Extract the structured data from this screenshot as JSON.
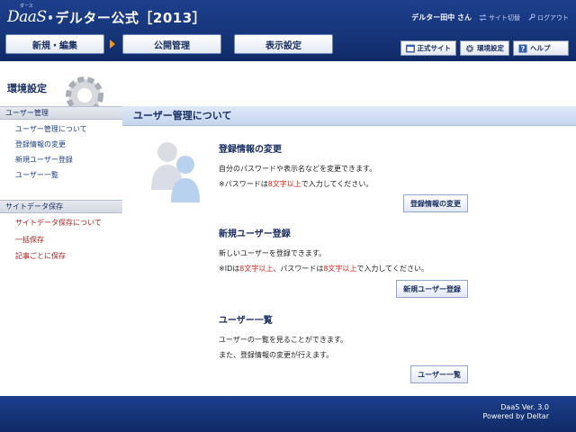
{
  "header": {
    "logo_daas": "DaaS",
    "logo_ruby": "ダース",
    "logo_title": "デルター公式［2013］",
    "user_name": "デルター田中 さん",
    "site_switch": "サイト切替",
    "logout": "ログアウト",
    "nav": [
      "新規・編集",
      "公開管理",
      "表示設定"
    ],
    "tools": {
      "official_site": "正式サイト",
      "env_settings": "環境設定",
      "help": "ヘルプ"
    }
  },
  "sidebar": {
    "title": "環境設定",
    "sections": [
      {
        "heading": "ユーザー管理",
        "items": [
          "ユーザー管理について",
          "登録情報の変更",
          "新規ユーザー登録",
          "ユーザー一覧"
        ]
      },
      {
        "heading": "サイトデータ保存",
        "items": [
          "サイトデータ保存について",
          "一括保存",
          "記事ごとに保存"
        ]
      }
    ]
  },
  "main": {
    "heading": "ユーザー管理について",
    "blocks": [
      {
        "title": "登録情報の変更",
        "line1": "自分のパスワードや表示名などを変更できます。",
        "line2_pre": "※パスワードは",
        "line2_red1": "8文字以上",
        "line2_post": "で入力してください。",
        "button": "登録情報の変更"
      },
      {
        "title": "新規ユーザー登録",
        "line1": "新しいユーザーを登録できます。",
        "line2_pre": "※IDは",
        "line2_red1": "8文字以上",
        "line2_mid": "、パスワードは",
        "line2_red2": "8文字以上",
        "line2_post": "で入力してください。",
        "button": "新規ユーザー登録"
      },
      {
        "title": "ユーザー一覧",
        "line1": "ユーザーの一覧を見ることができます。",
        "line2": "また、登録情報の変更が行えます。",
        "button": "ユーザー一覧"
      }
    ]
  },
  "footer": {
    "version": "DaaS Ver. 3.0",
    "powered": "Powered by Deltar"
  },
  "colors": {
    "header_bg": "#1d3f8c",
    "accent_orange": "#f39a1a",
    "required_red": "#e0261a",
    "link_red": "#b21c1c"
  },
  "icons": {
    "site_switch": "swap-icon",
    "logout": "wrench-icon",
    "official_site": "window-icon",
    "env_settings": "gear-icon",
    "help": "question-icon",
    "sidebar_title": "gear-icon",
    "main": "users-icon"
  }
}
